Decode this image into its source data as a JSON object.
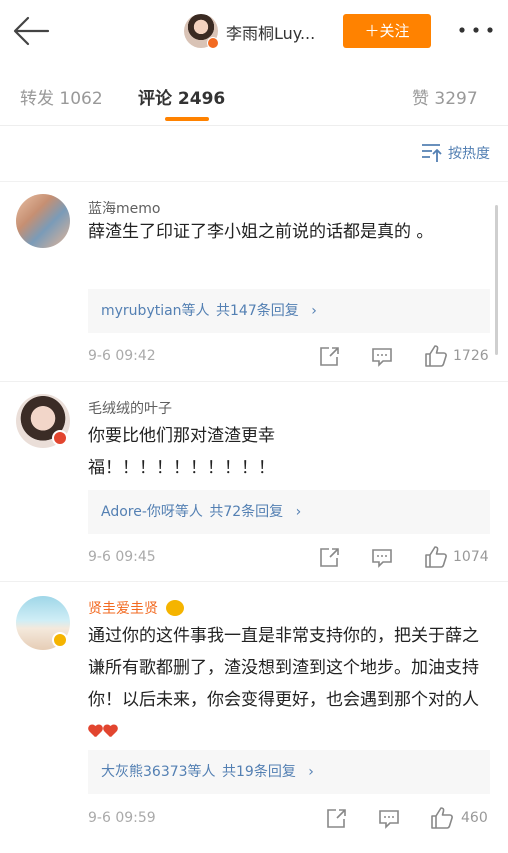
{
  "header": {
    "title": "李雨桐Luy...",
    "follow_label": "＋关注"
  },
  "tabs": {
    "repost": "转发 1062",
    "comments": "评论 2496",
    "likes": "赞 3297"
  },
  "sort": {
    "label": "按热度"
  },
  "comments": [
    {
      "name": "蓝海memo",
      "text": "薛渣生了印证了李小姐之前说的话都是真的 。",
      "reply_who": "myrubytian等人",
      "reply_count": "共147条回复",
      "time": "9-6 09:42",
      "likes": "1726"
    },
    {
      "name": "毛绒绒的叶子",
      "text": "你要比他们那对渣渣更幸福！！！！！！！！！！",
      "reply_who": "Adore-你呀等人",
      "reply_count": "共72条回复",
      "time": "9-6 09:45",
      "likes": "1074"
    },
    {
      "name": "贤圭爱圭贤",
      "text": "通过你的这件事我一直是非常支持你的，把关于薛之谦所有歌都删了，渣没想到渣到这个地步。加油支持你！以后未来，你会变得更好，也会遇到那个对的人",
      "reply_who": "大灰熊36373等人",
      "reply_count": "共19条回复",
      "time": "9-6 09:59",
      "likes": "460"
    }
  ],
  "colors": {
    "accent": "#ff8200",
    "link": "#5480b3",
    "vip_name": "#f26a21",
    "heart": "#e2452f"
  }
}
